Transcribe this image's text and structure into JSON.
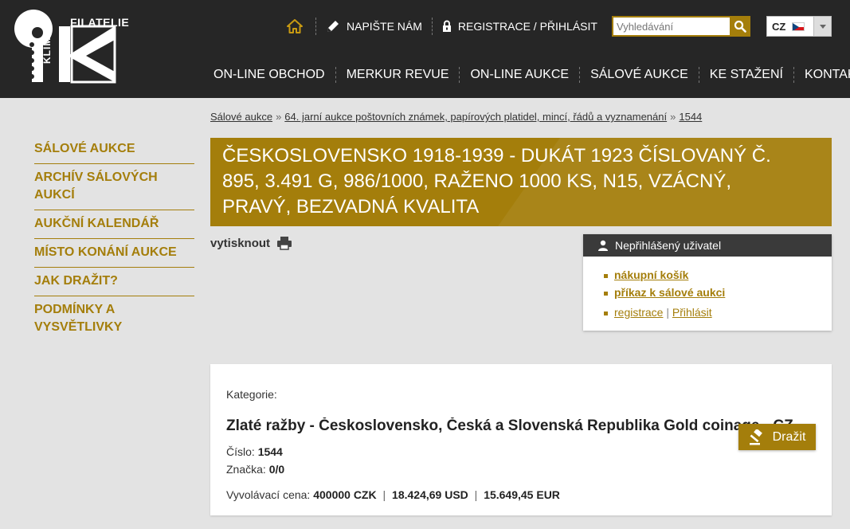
{
  "brand": {
    "logo_top": "FILATELIE",
    "logo_side": "KLIM"
  },
  "topbar": {
    "write_us": "NAPIŠTE NÁM",
    "register_login": "REGISTRACE / PŘIHLÁSIT",
    "search_placeholder": "Vyhledávání",
    "lang_code": "CZ"
  },
  "mainnav": [
    "ON-LINE OBCHOD",
    "MERKUR REVUE",
    "ON-LINE AUKCE",
    "SÁLOVÉ AUKCE",
    "KE STAŽENÍ",
    "KONTAKT"
  ],
  "sidebar": [
    "SÁLOVÉ AUKCE",
    "ARCHÍV SÁLOVÝCH AUKCÍ",
    "AUKČNÍ KALENDÁŘ",
    "MÍSTO KONÁNÍ AUKCE",
    "JAK DRAŽIT?",
    "PODMÍNKY A VYSVĚTLIVKY"
  ],
  "breadcrumb": {
    "b1": "Sálové aukce",
    "b2": "64. jarní aukce poštovních známek, papírových platidel, mincí, řádů a vyznamenání",
    "b3": "1544",
    "sep": "»"
  },
  "item": {
    "title": "Československo 1918-1939 - DUKÁT 1923 ČÍSLOVANÝ Č. 895, 3.491 G, 986/1000, RAŽENO 1000 KS, N15, VZÁCNÝ, PRAVÝ, BEZVADNÁ KVALITA",
    "print_label": "vytisknout",
    "category_label": "Kategorie:",
    "category_value": "Zlaté ražby - Československo, Česká a Slovenská Republika Gold coinage - CZ",
    "number_label": "Číslo:",
    "number_value": "1544",
    "mark_label": "Značka:",
    "mark_value": "0/0",
    "price_label": "Vyvolávací cena:",
    "price_czk": "400000 CZK",
    "price_usd": "18.424,69 USD",
    "price_eur": "15.649,45 EUR",
    "price_sep": "|",
    "bid_label": "Dražit"
  },
  "userbox": {
    "title": "Nepřihlášený uživatel",
    "cart": "nákupní košík",
    "order": "příkaz k sálové aukci",
    "register": "registrace",
    "auth_sep": "|",
    "login": "Přihlásit"
  },
  "colors": {
    "accent": "#a47e0b",
    "header_bg": "#262626",
    "page_bg": "#e3e3e3"
  }
}
